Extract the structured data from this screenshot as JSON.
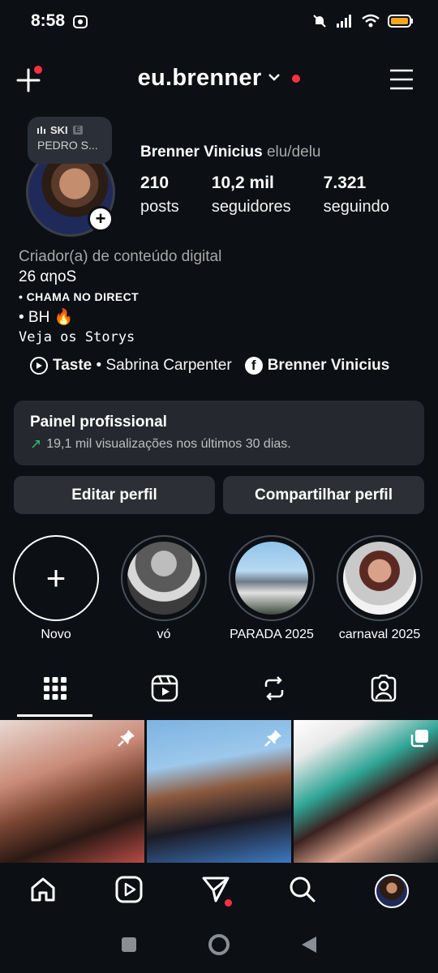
{
  "status": {
    "time": "8:58"
  },
  "header": {
    "username": "eu.brenner"
  },
  "note": {
    "line1": "SKI",
    "badge": "E",
    "line2": "PEDRO S..."
  },
  "profile": {
    "full_name": "Brenner Vinicius",
    "pronouns": "elu/delu",
    "stats": [
      {
        "num": "210",
        "label": "posts"
      },
      {
        "num": "10,2 mil",
        "label": "seguidores"
      },
      {
        "num": "7.321",
        "label": "seguindo"
      }
    ],
    "bio": {
      "category": "Criador(a) de conteúdo digital",
      "line1": "26 αηoS",
      "line2": "• CHAMA NO DIRECT",
      "line3": "• BH 🔥",
      "line4": "Veja os Storys"
    },
    "music_title": "Taste",
    "music_artist": "• Sabrina Carpenter",
    "facebook_name": "Brenner Vinicius"
  },
  "panel": {
    "title": "Painel profissional",
    "subtitle": "19,1 mil visualizações nos últimos 30 dias."
  },
  "buttons": {
    "edit": "Editar perfil",
    "share": "Compartilhar perfil"
  },
  "highlights": [
    {
      "label": "Novo"
    },
    {
      "label": "vó"
    },
    {
      "label": "PARADA 2025"
    },
    {
      "label": "carnaval 2025"
    }
  ],
  "colors": {
    "background": "#0c0f14",
    "accent_red": "#ff3040",
    "panel": "#25292f",
    "growth_green": "#27c46a"
  }
}
